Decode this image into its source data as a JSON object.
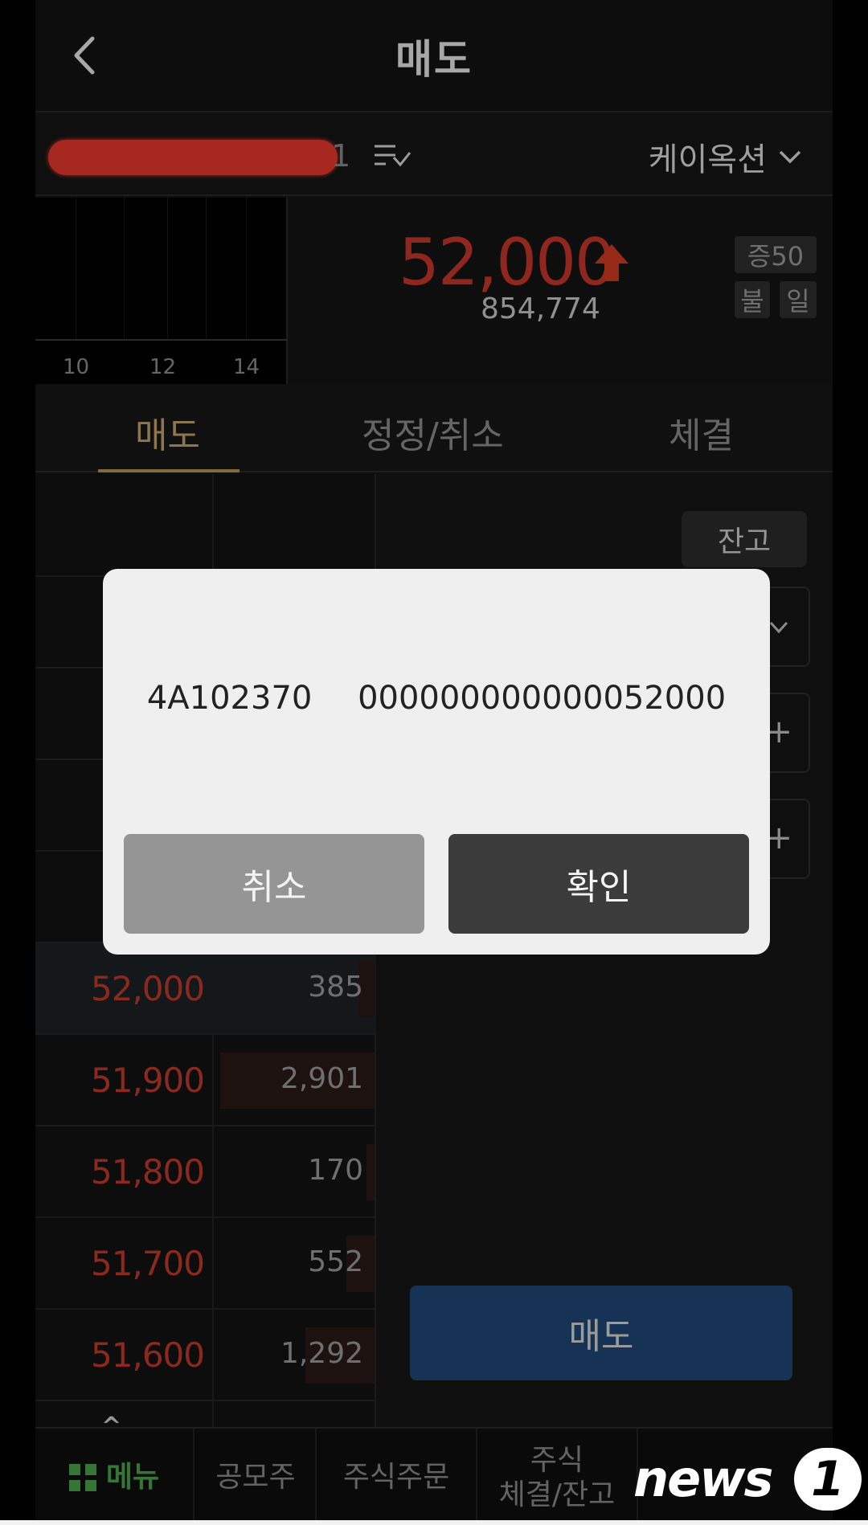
{
  "header": {
    "title": "매도"
  },
  "stock": {
    "market_label": "케이옥션",
    "redaction_tail": "1"
  },
  "chart": {
    "ticks": [
      "10",
      "12",
      "14"
    ]
  },
  "quote": {
    "price": "52,000",
    "volume": "854,774",
    "tags": {
      "margin": "증50",
      "b1": "불",
      "b2": "일"
    },
    "price_color": "#c8372b"
  },
  "tabs": [
    {
      "label": "매도",
      "active": true
    },
    {
      "label": "정정/취소",
      "active": false
    },
    {
      "label": "체결",
      "active": false
    }
  ],
  "orderbook": {
    "rows": [
      {
        "price": "52,000",
        "qty": "385",
        "fill": 0.1
      },
      {
        "price": "51,900",
        "qty": "2,901",
        "fill": 0.98
      },
      {
        "price": "51,800",
        "qty": "170",
        "fill": 0.05
      },
      {
        "price": "51,700",
        "qty": "552",
        "fill": 0.18
      },
      {
        "price": "51,600",
        "qty": "1,292",
        "fill": 0.44
      }
    ]
  },
  "order_panel": {
    "balance_label": "잔고",
    "sell_button": "매도"
  },
  "dialog": {
    "code": "4A102370",
    "value": "000000000000052000",
    "cancel_label": "취소",
    "confirm_label": "확인"
  },
  "bottom_nav": {
    "menu": "메뉴",
    "ipo": "공모주",
    "stock_order": "주식주문",
    "fills_line1": "주식",
    "fills_line2": "체결/잔고"
  },
  "watermark": {
    "text": "news",
    "badge": "1"
  },
  "colors": {
    "accent_tab": "#c2a46a",
    "ask_price": "#c23a2c",
    "sell_button": "#1f4677",
    "menu_green": "#4aa34a"
  },
  "icons": {
    "back": "chevron-left-icon",
    "list": "list-check-icon",
    "dropdown": "chevron-down-icon",
    "up": "arrow-up-icon",
    "menu": "grid-icon"
  }
}
